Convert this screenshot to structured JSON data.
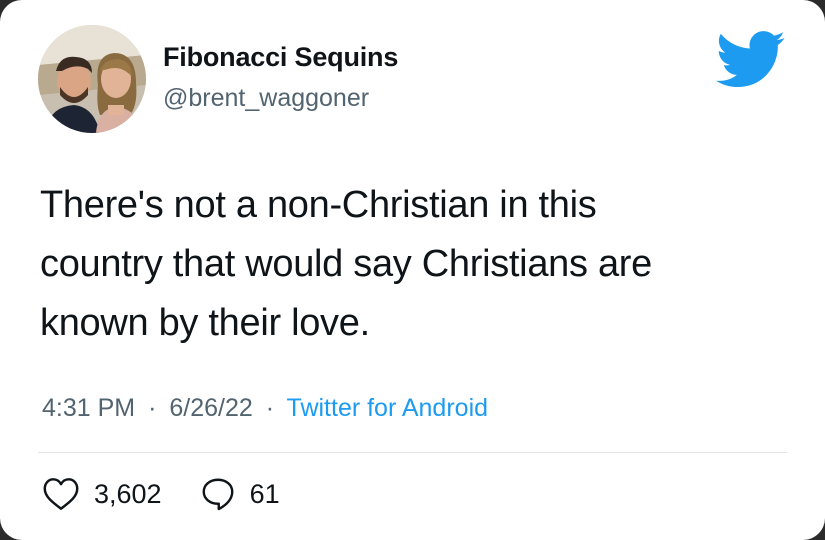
{
  "author": {
    "display_name": "Fibonacci Sequins",
    "handle": "@brent_waggoner",
    "avatar_icon": "profile-photo-couple"
  },
  "brand": {
    "icon": "twitter-bird-icon",
    "color": "#1d9bf0"
  },
  "tweet": {
    "text_lines": [
      "There's not a non-Christian in this",
      "country that would say Christians are",
      "known by their love."
    ],
    "time": "4:31 PM",
    "date": "6/26/22",
    "separator": "·",
    "source": "Twitter for Android"
  },
  "stats": {
    "likes": "3,602",
    "replies": "61",
    "like_icon": "heart-icon",
    "reply_icon": "reply-bubble-icon"
  },
  "colors": {
    "text": "#0f1419",
    "muted": "#536471",
    "accent": "#1d9bf0"
  }
}
